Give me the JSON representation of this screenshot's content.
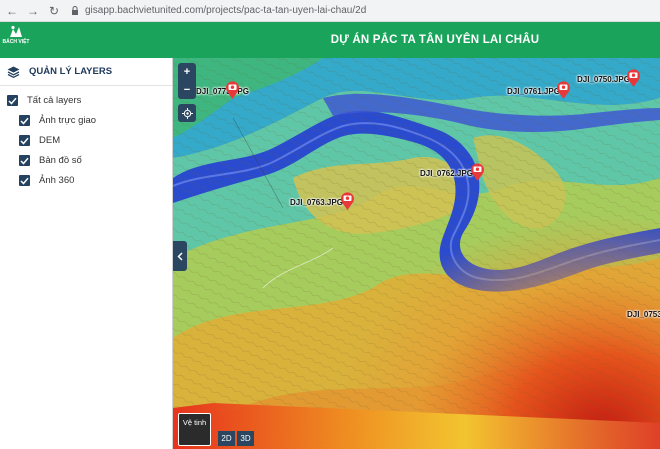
{
  "browser": {
    "url": "gisapp.bachvietunited.com/projects/pac-ta-tan-uyen-lai-chau/2d"
  },
  "header": {
    "logo_text": "BÁCH VIỆT",
    "title": "DỰ ÁN PẮC TA TÂN UYÊN LAI CHÂU"
  },
  "sidebar": {
    "title": "QUẢN LÝ LAYERS",
    "all_layers": {
      "label": "Tất cả layers",
      "checked": true
    },
    "layers": [
      {
        "label": "Ảnh trực giao",
        "checked": true
      },
      {
        "label": "DEM",
        "checked": true
      },
      {
        "label": "Bản đồ số",
        "checked": true
      },
      {
        "label": "Ảnh 360",
        "checked": true
      }
    ]
  },
  "map": {
    "zoom_in": "+",
    "zoom_out": "−",
    "basemap_label": "Vệ tinh",
    "mode_2d": "2D",
    "mode_3d": "3D",
    "markers": [
      {
        "label": "DJI_0773.JPG"
      },
      {
        "label": "DJI_0761.JPG"
      },
      {
        "label": "DJI_0750.JPG"
      },
      {
        "label": "DJI_0762.JPG"
      },
      {
        "label": "DJI_0763.JPG"
      },
      {
        "label": "DJI_0753"
      }
    ],
    "marker_color": "#e8393a"
  },
  "colors": {
    "header_bg": "#1aa35a",
    "panel_dark": "#2a4660"
  }
}
